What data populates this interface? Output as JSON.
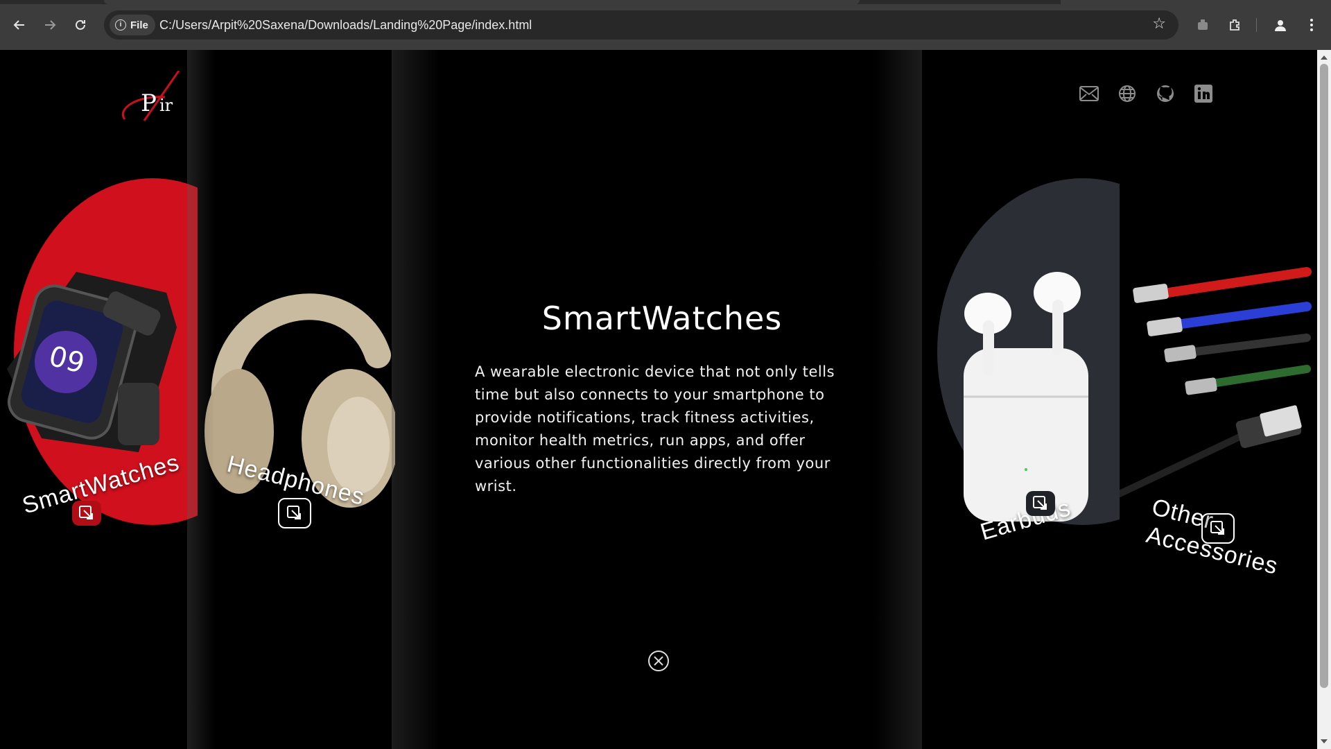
{
  "browser": {
    "site_chip": "File",
    "url": "C:/Users/Arpit%20Saxena/Downloads/Landing%20Page/index.html"
  },
  "logo": {
    "text_p": "P",
    "text_ir": "ir"
  },
  "panels": [
    {
      "label": "SmartWatches",
      "blob_color": "#d0101c"
    },
    {
      "label": "Headphones"
    },
    {
      "label": "Earbuds",
      "blob_color": "#2b2f35"
    },
    {
      "label_line1": "Other",
      "label_line2": "Accessories"
    }
  ],
  "content": {
    "title": "SmartWatches",
    "description": "A wearable electronic device that not only tells time but also connects to your smartphone to provide notifications, track fitness activities, monitor health metrics, run apps, and offer various other functionalities directly from your wrist."
  },
  "social_icons": [
    "mail-icon",
    "globe-icon",
    "github-icon",
    "linkedin-icon"
  ],
  "colors": {
    "accent_red": "#d0101c",
    "background": "#000000",
    "chrome": "#3c3c3c"
  }
}
